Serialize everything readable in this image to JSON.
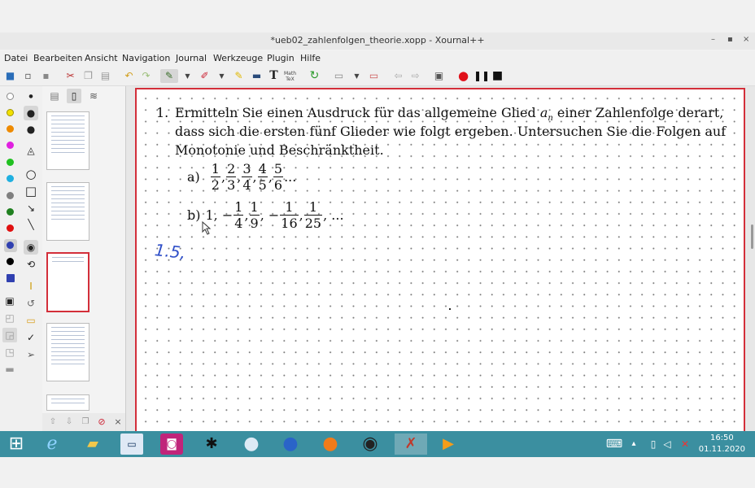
{
  "window": {
    "title": "*ueb02_zahlenfolgen_theorie.xopp - Xournal++"
  },
  "window_controls": {
    "minimize": "–",
    "maximize": "▪",
    "close": "×"
  },
  "menu": [
    "Datei",
    "Bearbeiten",
    "Ansicht",
    "Navigation",
    "Journal",
    "Werkzeuge",
    "Plugin",
    "Hilfe"
  ],
  "toolbar": {
    "icons": [
      "new-file-icon",
      "open-file-icon",
      "save-icon",
      "cut-icon",
      "copy-icon",
      "paste-icon",
      "undo-icon",
      "redo-icon",
      "pen-icon",
      "eraser-icon",
      "highlighter-icon",
      "hand-icon",
      "text-icon",
      "math-tex-icon",
      "refresh-icon",
      "insert-page-icon",
      "delete-page-icon",
      "previous-page-icon",
      "next-page-icon",
      "fullscreen-icon",
      "record-icon",
      "pause-icon",
      "stop-icon"
    ],
    "text_tool_label": "T",
    "tex_tool_label": "Math\nTeX"
  },
  "colors": {
    "record_red": "#e0101a",
    "page_border": "#d32f3a",
    "taskbar": "#3b8fa0",
    "ink_blue": "#3050c8"
  },
  "palette": [
    "#ffffff",
    "#f2e000",
    "#ee8a00",
    "#e020e0",
    "#20c020",
    "#20b0e0",
    "#808080",
    "#208020",
    "#e01010",
    "#3040b0",
    "#000000",
    "#3040b0"
  ],
  "exercise": {
    "number": "1.",
    "text_line1": "Ermitteln Sie einen Ausdruck für das allgemeine Glied",
    "symbol_a": "a",
    "symbol_sub": "n",
    "text_line1_tail": " einer Zahlenfolge derart,",
    "text_line2": "dass sich die ersten fünf Glieder wie folgt ergeben. Untersuchen Sie die Folgen auf",
    "text_line3": "Monotonie und Beschränktheit.",
    "part_a_label": "a)",
    "part_a_terms": [
      {
        "num": "1",
        "den": "2"
      },
      {
        "num": "2",
        "den": "3"
      },
      {
        "num": "3",
        "den": "4"
      },
      {
        "num": "4",
        "den": "5"
      },
      {
        "num": "5",
        "den": "6"
      }
    ],
    "part_a_tail": "...",
    "part_b_label": "b)",
    "part_b_first": "1, −",
    "part_b_terms": [
      {
        "num": "1",
        "den": "4"
      },
      {
        "num": "1",
        "den": "9"
      },
      {
        "num": "1",
        "den": "16"
      },
      {
        "num": "1",
        "den": "25"
      }
    ],
    "part_b_tail": ", ...",
    "handwriting": "1.5,"
  },
  "taskbar": {
    "time": "16:50",
    "date": "01.11.2020"
  }
}
